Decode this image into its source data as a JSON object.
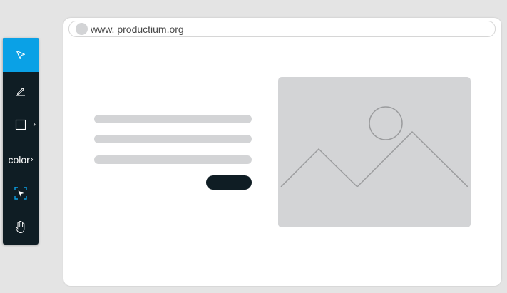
{
  "browser": {
    "url": "www. productium.org"
  },
  "toolbar": {
    "tools": [
      {
        "name": "select",
        "icon": "cursor-arrow-icon",
        "active": true
      },
      {
        "name": "draw",
        "icon": "pen-icon"
      },
      {
        "name": "shape",
        "icon": "square-icon",
        "has_submenu": true
      },
      {
        "name": "color",
        "label": "color",
        "has_submenu": true
      },
      {
        "name": "frame-select",
        "icon": "frame-select-icon"
      },
      {
        "name": "pan",
        "icon": "hand-icon"
      }
    ],
    "caret_glyph": "›"
  },
  "colors": {
    "toolbar_bg": "#0f1d24",
    "active_tool": "#0aa1e6",
    "frame_select_accent": "#0aa1e6",
    "placeholder_gray": "#d3d4d6",
    "button_dark": "#0f1d24"
  },
  "wireframe": {
    "text_lines": 3,
    "image_placeholder_icon": "mountain-sun-icon"
  }
}
